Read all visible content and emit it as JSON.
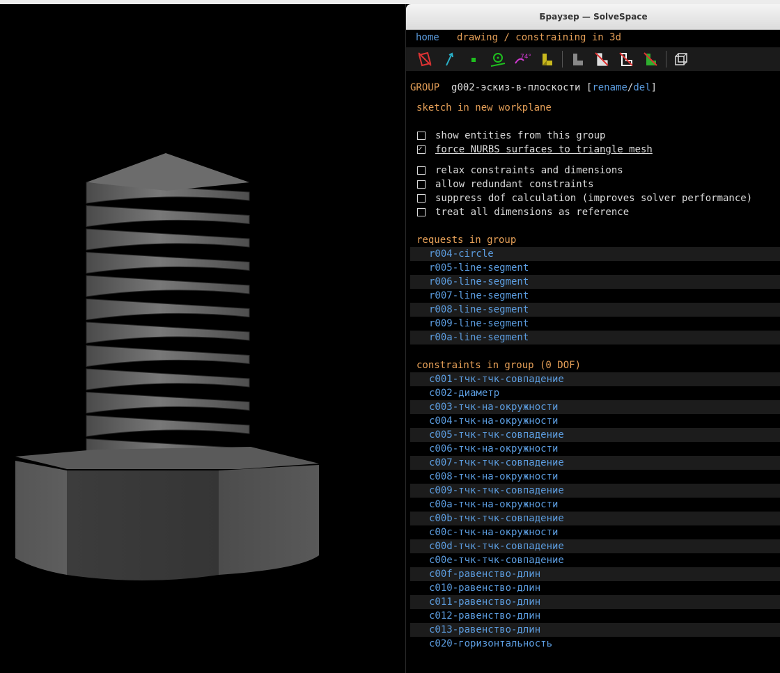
{
  "window": {
    "title": "Браузер — SolveSpace"
  },
  "nav": {
    "home": "home",
    "mode": "drawing / constraining in 3d"
  },
  "toolbar": {
    "icons": [
      "show-workplanes-icon",
      "show-normals-icon",
      "show-points-icon",
      "show-construction-icon",
      "show-constraints-icon",
      "show-faces-icon",
      "show-edges-icon",
      "show-outlines-icon",
      "show-hidden-lines-icon",
      "show-shaded-icon",
      "show-mesh-icon"
    ]
  },
  "group": {
    "label": "GROUP",
    "name": "g002-эскиз-в-плоскости",
    "bracket_open": "[",
    "rename": "rename",
    "slash": "/",
    "del": "del",
    "bracket_close": "]",
    "type": "sketch in new workplane"
  },
  "options": [
    {
      "label": "show entities from this group",
      "checked": false
    },
    {
      "label": "force NURBS surfaces to triangle mesh",
      "checked": true
    },
    {
      "label": "relax constraints and dimensions",
      "checked": false
    },
    {
      "label": "allow redundant constraints",
      "checked": false
    },
    {
      "label": "suppress dof calculation (improves solver performance)",
      "checked": false
    },
    {
      "label": "treat all dimensions as reference",
      "checked": false
    }
  ],
  "requests": {
    "heading": "requests in group",
    "items": [
      "r004-circle",
      "r005-line-segment",
      "r006-line-segment",
      "r007-line-segment",
      "r008-line-segment",
      "r009-line-segment",
      "r00a-line-segment"
    ]
  },
  "constraints": {
    "heading": "constraints in group (0 DOF)",
    "items": [
      "c001-тчк-тчк-совпадение",
      "c002-диаметр",
      "c003-тчк-на-окружности",
      "c004-тчк-на-окружности",
      "c005-тчк-тчк-совпадение",
      "c006-тчк-на-окружности",
      "c007-тчк-тчк-совпадение",
      "c008-тчк-на-окружности",
      "c009-тчк-тчк-совпадение",
      "c00a-тчк-на-окружности",
      "c00b-тчк-тчк-совпадение",
      "c00c-тчк-на-окружности",
      "c00d-тчк-тчк-совпадение",
      "c00e-тчк-тчк-совпадение",
      "c00f-равенство-длин",
      "c010-равенство-длин",
      "c011-равенство-длин",
      "c012-равенство-длин",
      "c013-равенство-длин",
      "c020-горизонтальность"
    ]
  },
  "colors": {
    "link": "#5c9de0",
    "heading": "#e6a058",
    "text": "#dcdcdc",
    "model": "#6e6e6e"
  }
}
